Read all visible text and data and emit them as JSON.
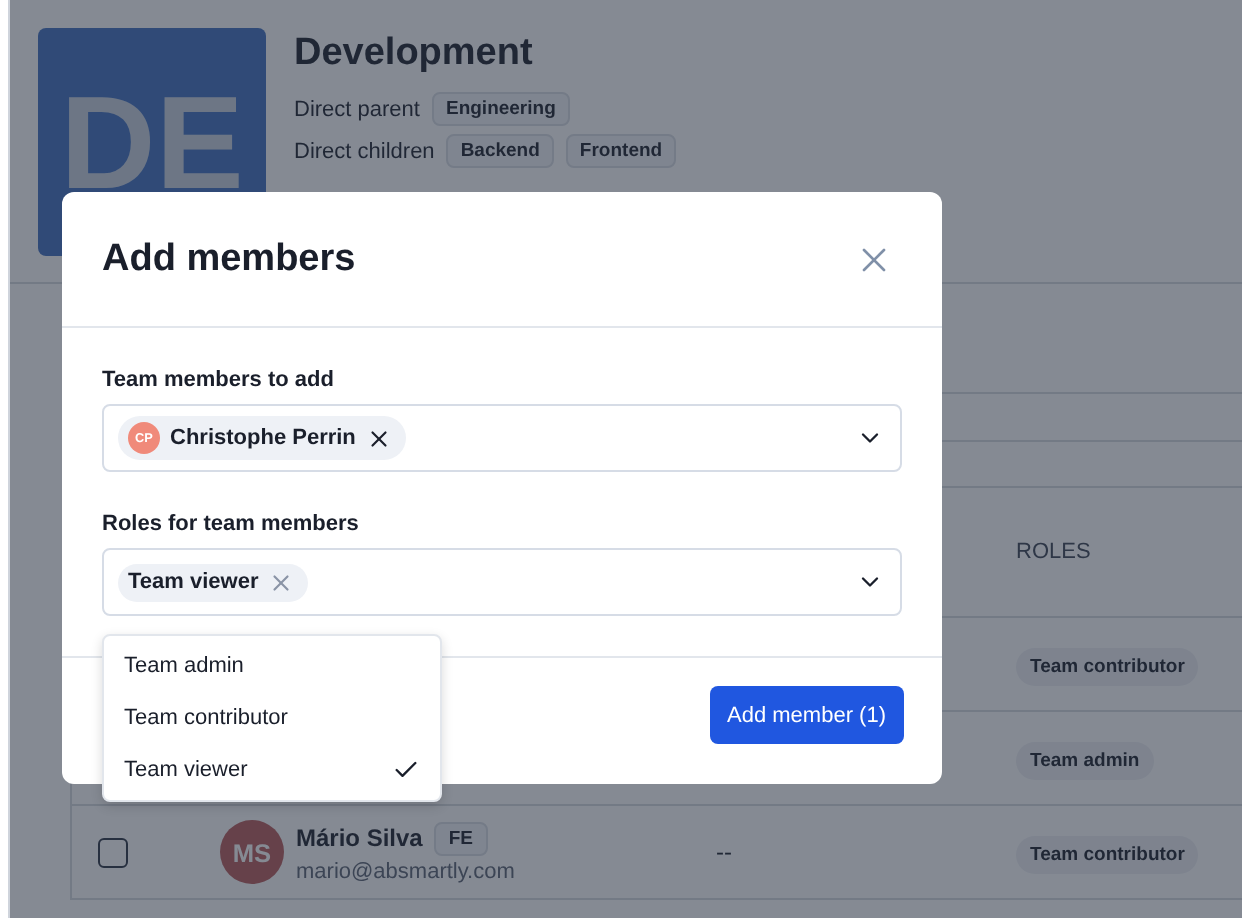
{
  "team": {
    "avatar": "DE",
    "title": "Development",
    "parent_label": "Direct parent",
    "parent_tags": [
      "Engineering"
    ],
    "children_label": "Direct children",
    "children_tags": [
      "Backend",
      "Frontend"
    ]
  },
  "table": {
    "columns": [
      {
        "label": "ROLES"
      }
    ],
    "rows": [
      {
        "roles": [
          "Team contributor"
        ]
      },
      {
        "roles": [
          "Team admin"
        ]
      },
      {
        "checked": false,
        "avatar": "MS",
        "name": "Mário Silva",
        "tag": "FE",
        "email": "mario@absmartly.com",
        "column_3": "--",
        "roles": [
          "Team contributor"
        ]
      }
    ]
  },
  "modal": {
    "title": "Add members",
    "fields": [
      {
        "label": "Team members to add",
        "chips": [
          {
            "avatar": "CP",
            "text": "Christophe Perrin"
          }
        ]
      },
      {
        "label": "Roles for team members",
        "chips": [
          {
            "text": "Team viewer"
          }
        ]
      }
    ],
    "options": [
      {
        "label": "Team admin",
        "selected": false
      },
      {
        "label": "Team contributor",
        "selected": false
      },
      {
        "label": "Team viewer",
        "selected": true
      }
    ],
    "submit": "Add member (1)"
  }
}
